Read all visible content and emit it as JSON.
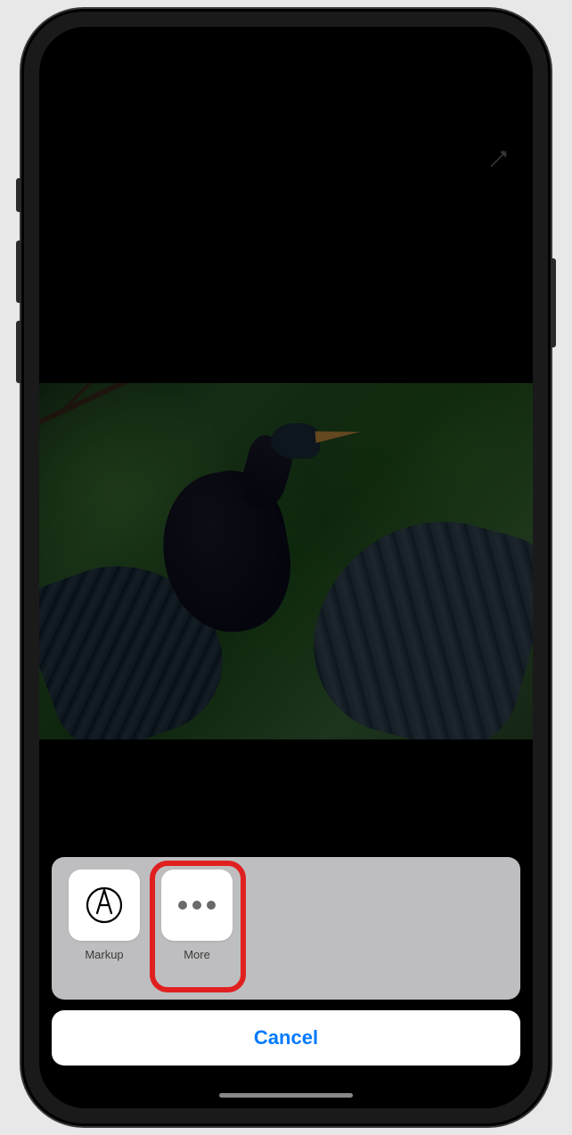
{
  "actionSheet": {
    "items": [
      {
        "id": "markup",
        "label": "Markup"
      },
      {
        "id": "more",
        "label": "More"
      }
    ],
    "cancel_label": "Cancel"
  },
  "toolbar": {
    "magic_icon": "magic-wand"
  },
  "highlight": {
    "target": "more"
  }
}
